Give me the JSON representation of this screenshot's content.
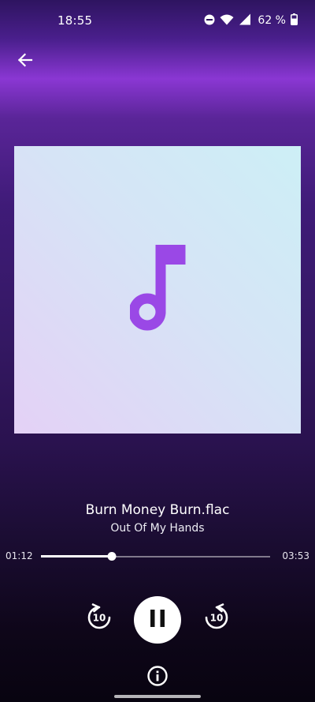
{
  "status_bar": {
    "time": "18:55",
    "battery_text": "62 %",
    "icons": [
      "do-not-disturb-icon",
      "wifi-icon",
      "cellular-signal-icon",
      "battery-icon"
    ]
  },
  "header": {
    "back_icon": "arrow-back-icon"
  },
  "album": {
    "placeholder_icon": "music-note-icon",
    "colors": {
      "gradient_start": "#cdeff6",
      "gradient_end": "#e4d1f6",
      "note": "#9a48e6"
    }
  },
  "track": {
    "title": "Burn Money Burn.flac",
    "artist": "Out Of My Hands"
  },
  "progress": {
    "current": "01:12",
    "total": "03:53",
    "fraction": 0.309
  },
  "controls": {
    "rewind_seconds": "10",
    "forward_seconds": "10",
    "state": "playing",
    "rewind_icon": "replay-10-icon",
    "pause_icon": "pause-icon",
    "forward_icon": "forward-10-icon",
    "info_icon": "info-icon"
  },
  "theme": {
    "accent": "#8a37d3"
  }
}
